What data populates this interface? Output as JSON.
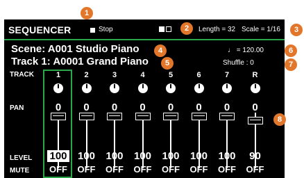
{
  "header": {
    "title": "SEQUENCER",
    "stop_label": "Stop",
    "length_label": "Length = 32",
    "scale_label": "Scale = 1/16"
  },
  "info": {
    "scene": "Scene:  A001  Studio Piano",
    "track": "Track 1: A0001  Grand Piano",
    "tempo": "♩ = 120.00",
    "shuffle": "Shuffle :   0"
  },
  "mixer": {
    "track_label": "TRACK",
    "pan_label": "PAN",
    "level_label": "LEVEL",
    "mute_label": "MUTE",
    "channels": [
      {
        "id": "1",
        "pan": "0",
        "level": "100",
        "level_fraction": 0.79,
        "mute": "OFF"
      },
      {
        "id": "2",
        "pan": "0",
        "level": "100",
        "level_fraction": 0.79,
        "mute": "OFF"
      },
      {
        "id": "3",
        "pan": "0",
        "level": "100",
        "level_fraction": 0.79,
        "mute": "OFF"
      },
      {
        "id": "4",
        "pan": "0",
        "level": "100",
        "level_fraction": 0.79,
        "mute": "OFF"
      },
      {
        "id": "5",
        "pan": "0",
        "level": "100",
        "level_fraction": 0.79,
        "mute": "OFF"
      },
      {
        "id": "6",
        "pan": "0",
        "level": "100",
        "level_fraction": 0.79,
        "mute": "OFF"
      },
      {
        "id": "7",
        "pan": "0",
        "level": "100",
        "level_fraction": 0.79,
        "mute": "OFF"
      },
      {
        "id": "R",
        "pan": "0",
        "level": "90",
        "level_fraction": 0.71,
        "mute": "OFF"
      }
    ]
  },
  "badges": [
    "1",
    "2",
    "3",
    "4",
    "5",
    "6",
    "7",
    "8"
  ],
  "colors": {
    "accent": "#2aa84a",
    "badge": "#e2762a",
    "screen": "#000000"
  }
}
